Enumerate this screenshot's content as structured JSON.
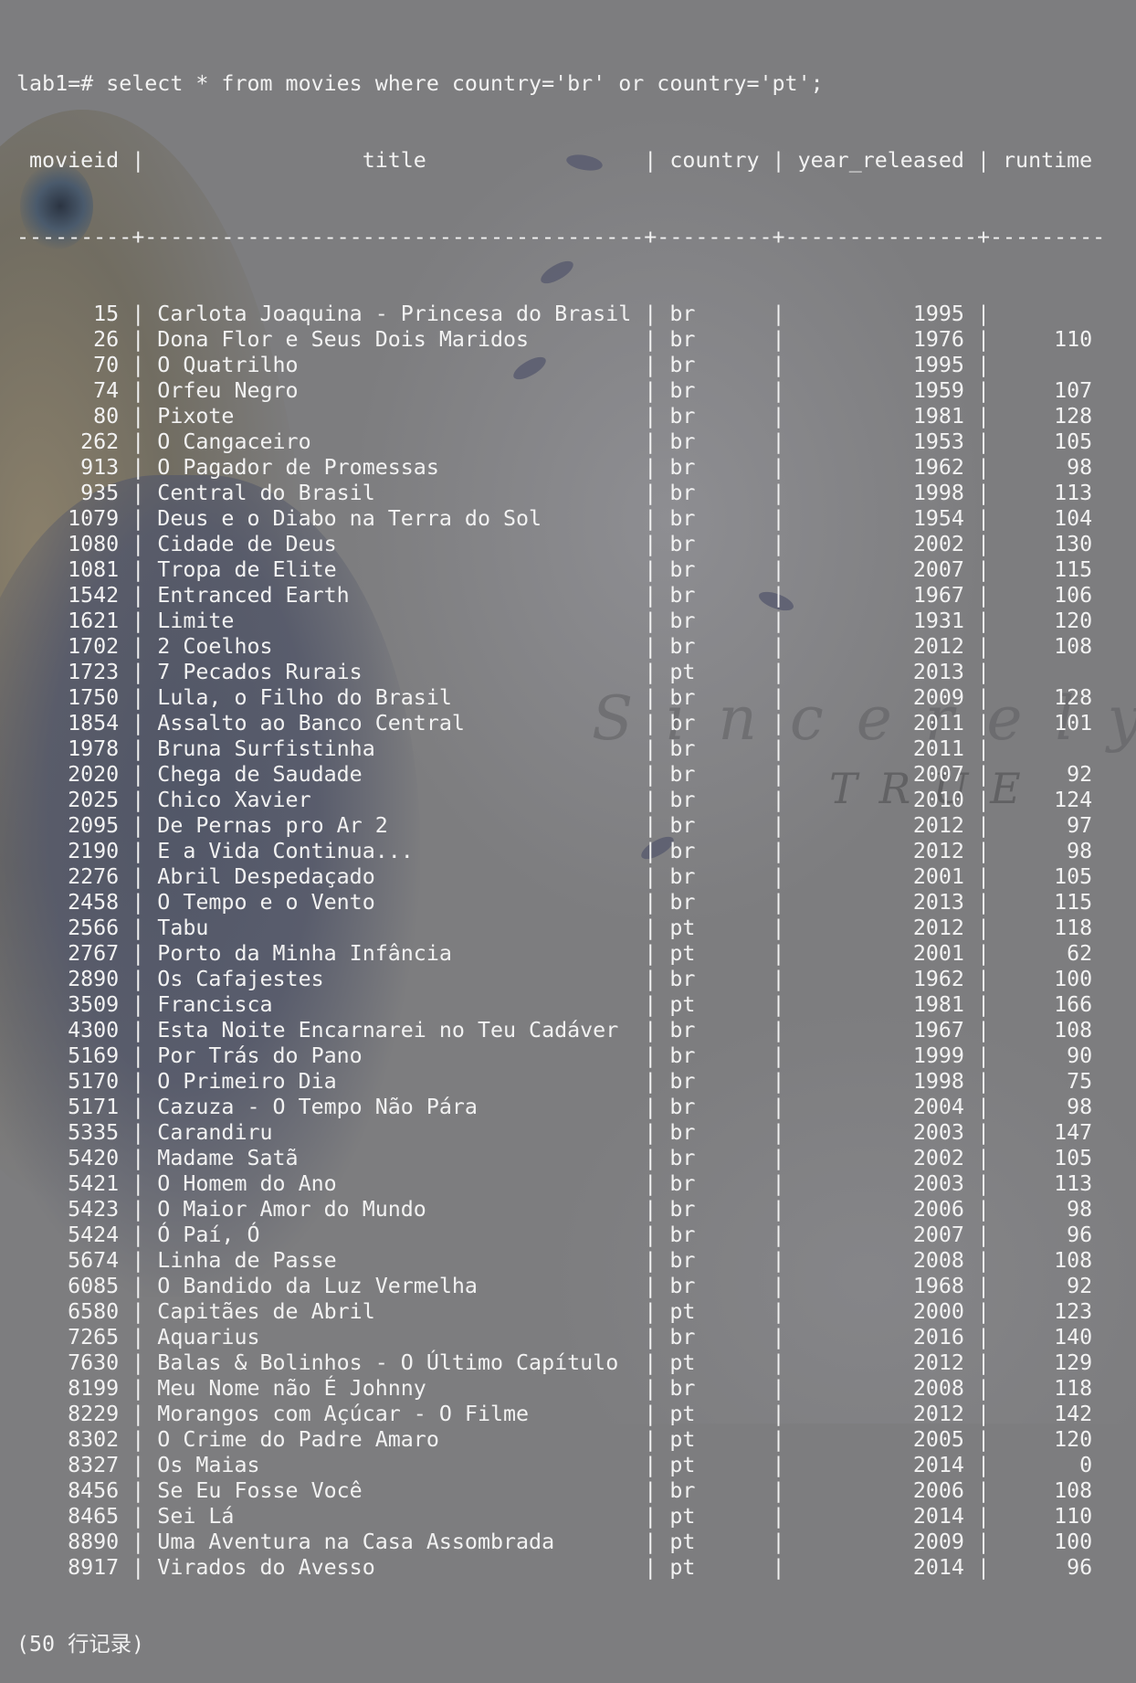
{
  "prompt": "lab1=# ",
  "query": "select * from movies where country='br' or country='pt';",
  "columns": [
    "movieid",
    "title",
    "country",
    "year_released",
    "runtime"
  ],
  "rows": [
    [
      "15",
      "Carlota Joaquina - Princesa do Brasil",
      "br",
      "1995",
      ""
    ],
    [
      "26",
      "Dona Flor e Seus Dois Maridos",
      "br",
      "1976",
      "110"
    ],
    [
      "70",
      "O Quatrilho",
      "br",
      "1995",
      ""
    ],
    [
      "74",
      "Orfeu Negro",
      "br",
      "1959",
      "107"
    ],
    [
      "80",
      "Pixote",
      "br",
      "1981",
      "128"
    ],
    [
      "262",
      "O Cangaceiro",
      "br",
      "1953",
      "105"
    ],
    [
      "913",
      "O Pagador de Promessas",
      "br",
      "1962",
      "98"
    ],
    [
      "935",
      "Central do Brasil",
      "br",
      "1998",
      "113"
    ],
    [
      "1079",
      "Deus e o Diabo na Terra do Sol",
      "br",
      "1954",
      "104"
    ],
    [
      "1080",
      "Cidade de Deus",
      "br",
      "2002",
      "130"
    ],
    [
      "1081",
      "Tropa de Elite",
      "br",
      "2007",
      "115"
    ],
    [
      "1542",
      "Entranced Earth",
      "br",
      "1967",
      "106"
    ],
    [
      "1621",
      "Limite",
      "br",
      "1931",
      "120"
    ],
    [
      "1702",
      "2 Coelhos",
      "br",
      "2012",
      "108"
    ],
    [
      "1723",
      "7 Pecados Rurais",
      "pt",
      "2013",
      ""
    ],
    [
      "1750",
      "Lula, o Filho do Brasil",
      "br",
      "2009",
      "128"
    ],
    [
      "1854",
      "Assalto ao Banco Central",
      "br",
      "2011",
      "101"
    ],
    [
      "1978",
      "Bruna Surfistinha",
      "br",
      "2011",
      ""
    ],
    [
      "2020",
      "Chega de Saudade",
      "br",
      "2007",
      "92"
    ],
    [
      "2025",
      "Chico Xavier",
      "br",
      "2010",
      "124"
    ],
    [
      "2095",
      "De Pernas pro Ar 2",
      "br",
      "2012",
      "97"
    ],
    [
      "2190",
      "E a Vida Continua...",
      "br",
      "2012",
      "98"
    ],
    [
      "2276",
      "Abril Despedaçado",
      "br",
      "2001",
      "105"
    ],
    [
      "2458",
      "O Tempo e o Vento",
      "br",
      "2013",
      "115"
    ],
    [
      "2566",
      "Tabu",
      "pt",
      "2012",
      "118"
    ],
    [
      "2767",
      "Porto da Minha Infância",
      "pt",
      "2001",
      "62"
    ],
    [
      "2890",
      "Os Cafajestes",
      "br",
      "1962",
      "100"
    ],
    [
      "3509",
      "Francisca",
      "pt",
      "1981",
      "166"
    ],
    [
      "4300",
      "Esta Noite Encarnarei no Teu Cadáver",
      "br",
      "1967",
      "108"
    ],
    [
      "5169",
      "Por Trás do Pano",
      "br",
      "1999",
      "90"
    ],
    [
      "5170",
      "O Primeiro Dia",
      "br",
      "1998",
      "75"
    ],
    [
      "5171",
      "Cazuza - O Tempo Não Pára",
      "br",
      "2004",
      "98"
    ],
    [
      "5335",
      "Carandiru",
      "br",
      "2003",
      "147"
    ],
    [
      "5420",
      "Madame Satã",
      "br",
      "2002",
      "105"
    ],
    [
      "5421",
      "O Homem do Ano",
      "br",
      "2003",
      "113"
    ],
    [
      "5423",
      "O Maior Amor do Mundo",
      "br",
      "2006",
      "98"
    ],
    [
      "5424",
      "Ó Paí, Ó",
      "br",
      "2007",
      "96"
    ],
    [
      "5674",
      "Linha de Passe",
      "br",
      "2008",
      "108"
    ],
    [
      "6085",
      "O Bandido da Luz Vermelha",
      "br",
      "1968",
      "92"
    ],
    [
      "6580",
      "Capitães de Abril",
      "pt",
      "2000",
      "123"
    ],
    [
      "7265",
      "Aquarius",
      "br",
      "2016",
      "140"
    ],
    [
      "7630",
      "Balas & Bolinhos - O Último Capítulo",
      "pt",
      "2012",
      "129"
    ],
    [
      "8199",
      "Meu Nome não É Johnny",
      "br",
      "2008",
      "118"
    ],
    [
      "8229",
      "Morangos com Açúcar - O Filme",
      "pt",
      "2012",
      "142"
    ],
    [
      "8302",
      "O Crime do Padre Amaro",
      "pt",
      "2005",
      "120"
    ],
    [
      "8327",
      "Os Maias",
      "pt",
      "2014",
      "0"
    ],
    [
      "8456",
      "Se Eu Fosse Você",
      "br",
      "2006",
      "108"
    ],
    [
      "8465",
      "Sei Lá",
      "pt",
      "2014",
      "110"
    ],
    [
      "8890",
      "Uma Aventura na Casa Assombrada",
      "pt",
      "2009",
      "100"
    ],
    [
      "8917",
      "Virados do Avesso",
      "pt",
      "2014",
      "96"
    ]
  ],
  "footer": "(50 行记录)",
  "background": {
    "watermark_line1": "Sincerely",
    "watermark_line2": "TRUE"
  },
  "colors": {
    "text": "#f2f2f2",
    "background": "#7d7d7f"
  }
}
